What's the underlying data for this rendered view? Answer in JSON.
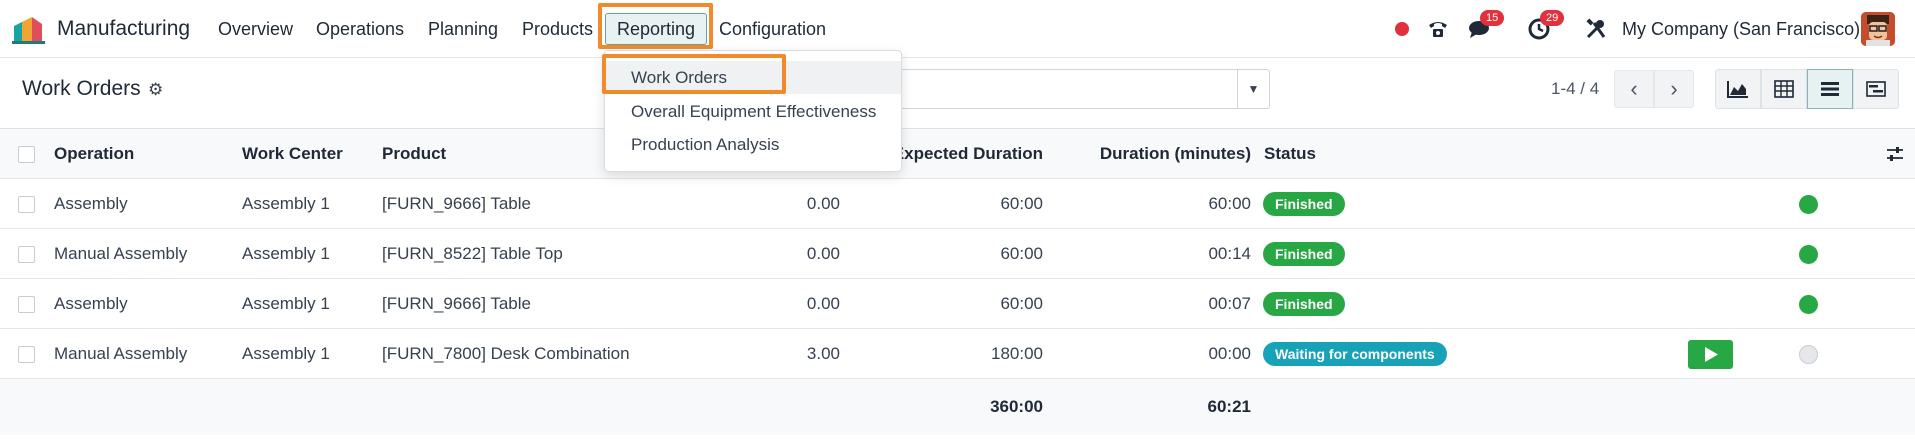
{
  "nav": {
    "app_name": "Manufacturing",
    "menu": [
      "Overview",
      "Operations",
      "Planning",
      "Products",
      "Reporting",
      "Configuration"
    ],
    "chat_badge": "15",
    "activity_badge": "29",
    "company": "My Company (San Francisco)"
  },
  "reporting_menu": {
    "items": [
      "Work Orders",
      "Overall Equipment Effectiveness",
      "Production Analysis"
    ]
  },
  "control_panel": {
    "title": "Work Orders",
    "pager": "1-4 / 4"
  },
  "table": {
    "columns": [
      "Operation",
      "Work Center",
      "Product",
      "Expected Duration",
      "Duration (minutes)",
      "Status"
    ],
    "rows": [
      {
        "operation": "Assembly",
        "work_center": "Assembly 1",
        "product": "[FURN_9666] Table",
        "quantity": "0.00",
        "expected": "60:00",
        "duration": "60:00",
        "status": "Finished",
        "status_color": "#28a745",
        "dot": "#28a745"
      },
      {
        "operation": "Manual Assembly",
        "work_center": "Assembly 1",
        "product": "[FURN_8522] Table Top",
        "quantity": "0.00",
        "expected": "60:00",
        "duration": "00:14",
        "status": "Finished",
        "status_color": "#28a745",
        "dot": "#28a745"
      },
      {
        "operation": "Assembly",
        "work_center": "Assembly 1",
        "product": "[FURN_9666] Table",
        "quantity": "0.00",
        "expected": "60:00",
        "duration": "00:07",
        "status": "Finished",
        "status_color": "#28a745",
        "dot": "#28a745"
      },
      {
        "operation": "Manual Assembly",
        "work_center": "Assembly 1",
        "product": "[FURN_7800] Desk Combination",
        "quantity": "3.00",
        "expected": "180:00",
        "duration": "00:00",
        "status": "Waiting for components",
        "status_color": "#17a2b8",
        "dot": "#e5e7eb"
      }
    ],
    "totals": {
      "expected": "360:00",
      "duration": "60:21"
    }
  },
  "colors": {
    "highlight": "#f28a2c",
    "primary": "#714b67",
    "success": "#28a745",
    "info": "#17a2b8"
  }
}
